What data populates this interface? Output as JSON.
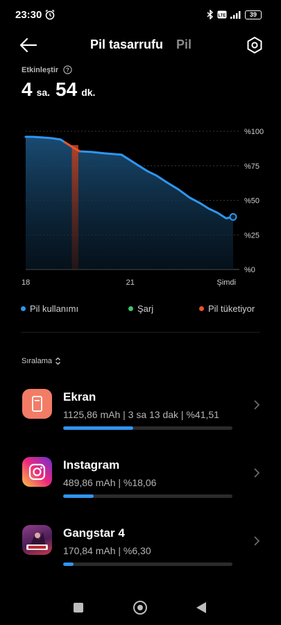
{
  "status_bar": {
    "time": "23:30",
    "network_label": "Vo LTE",
    "battery": "39"
  },
  "header": {
    "tab_active": "Pil tasarrufu",
    "tab_inactive": "Pil",
    "icons": {
      "back": "arrow-left-icon",
      "settings": "settings-gear-icon"
    }
  },
  "summary": {
    "label": "Etkinleştir",
    "hours_value": "4",
    "hours_unit": "sa.",
    "minutes_value": "54",
    "minutes_unit": "dk."
  },
  "chart_data": {
    "type": "area",
    "x_ticks": [
      "18",
      "21",
      "Şimdi"
    ],
    "y_ticks": [
      "%100",
      "%75",
      "%50",
      "%25",
      "%0"
    ],
    "ylim": [
      0,
      100
    ],
    "x": [
      0,
      0.08,
      0.2,
      0.3,
      0.4,
      0.45,
      0.55,
      0.62,
      0.75,
      0.9,
      1.0,
      1.1,
      1.2,
      1.3,
      1.4,
      1.5,
      1.62,
      1.75,
      1.88,
      2.0,
      2.1,
      2.2,
      2.3,
      2.38
    ],
    "values": [
      96,
      96,
      95.5,
      95,
      94,
      92,
      88,
      85.5,
      85,
      84,
      83.5,
      83,
      79,
      75,
      71,
      68,
      63,
      58,
      52,
      48,
      44,
      41,
      37,
      38
    ],
    "series": [
      {
        "name": "Pil kullanımı",
        "color": "#2f95f0"
      }
    ],
    "drain_highlight": {
      "x_start": 0.45,
      "x_end": 0.62,
      "label": "Pil tüketiyor",
      "color": "#e8532a"
    },
    "grid": true
  },
  "legend": [
    {
      "label": "Pil kullanımı",
      "color": "#2f95f0"
    },
    {
      "label": "Şarj",
      "color": "#3ec46d"
    },
    {
      "label": "Pil tüketiyor",
      "color": "#e8532a"
    }
  ],
  "sort": {
    "label": "Sıralama"
  },
  "apps": [
    {
      "name": "Ekran",
      "detail": "1125,86 mAh | 3 sa 13 dak  | %41,51",
      "usage_fraction": 0.4151,
      "icon": "screen-icon"
    },
    {
      "name": "Instagram",
      "detail": "489,86 mAh | %18,06",
      "usage_fraction": 0.1806,
      "icon": "instagram-icon"
    },
    {
      "name": "Gangstar 4",
      "detail": "170,84 mAh | %6,30",
      "usage_fraction": 0.063,
      "icon": "gangstar-game-icon"
    }
  ],
  "colors": {
    "accent": "#2f95f0",
    "charge": "#3ec46d",
    "drain": "#e8532a"
  }
}
